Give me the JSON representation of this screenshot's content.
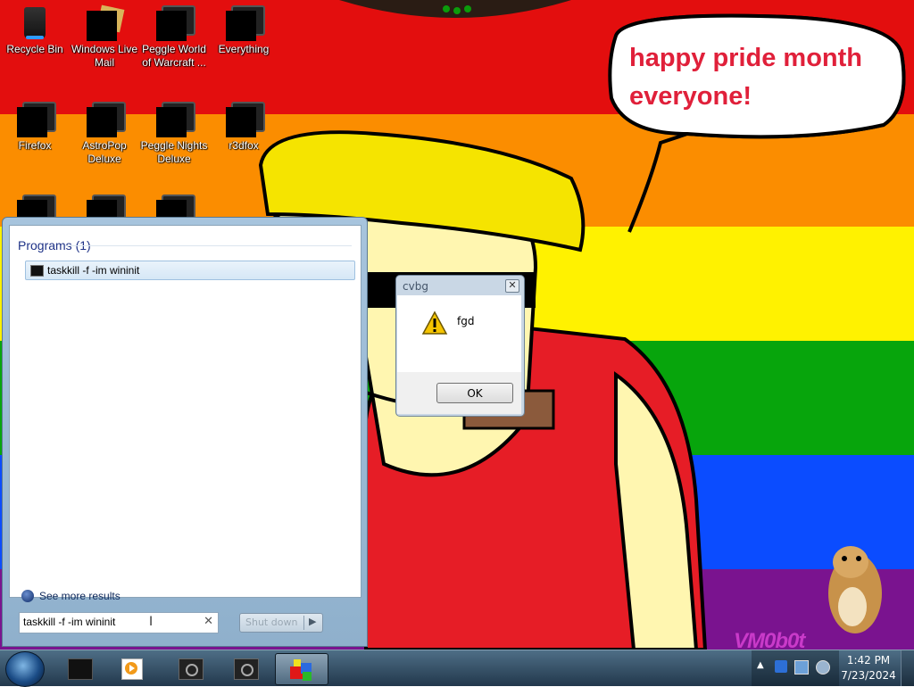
{
  "desktop": {
    "icons": [
      {
        "label": "Recycle Bin"
      },
      {
        "label": "Windows Live Mail"
      },
      {
        "label": "Peggle World of Warcraft ..."
      },
      {
        "label": "Everything"
      },
      {
        "label": "Firefox"
      },
      {
        "label": "AstroPop Deluxe"
      },
      {
        "label": "Peggle Nights Deluxe"
      },
      {
        "label": "r3dfox"
      }
    ],
    "speech_bubble": "happy pride month everyone!",
    "watermark": "VM0b0t",
    "colors": {
      "red": "#e30e0e",
      "orange": "#fb8d00",
      "yellow": "#fff200",
      "green": "#07a50c",
      "blue": "#0b4cff",
      "purple": "#7a138f"
    }
  },
  "start_menu": {
    "programs_header": "Programs (1)",
    "result": "taskkill -f -im wininit",
    "see_more": "See more results",
    "search_value": "taskkill -f -im wininit",
    "shutdown_label": "Shut down"
  },
  "message_box": {
    "title": "cvbg",
    "message": "fgd",
    "ok_label": "OK",
    "close_symbol": "✕",
    "icon": "warning-icon"
  },
  "taskbar": {
    "clock_time": "1:42 PM",
    "clock_date": "7/23/2024",
    "tray_up": "▲"
  }
}
